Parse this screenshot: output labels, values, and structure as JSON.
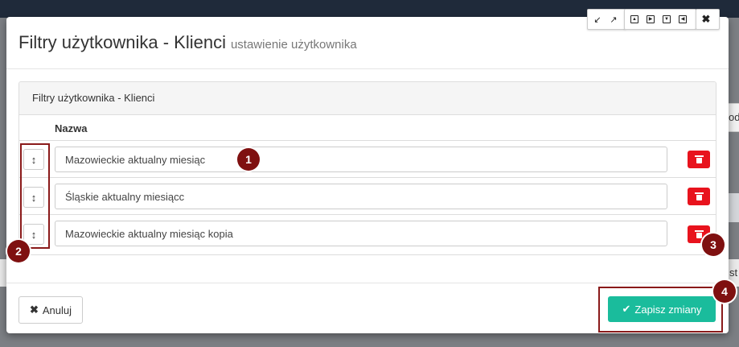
{
  "modal": {
    "title": "Filtry użytkownika - Klienci",
    "subtitle": "ustawienie użytkownika"
  },
  "window_controls": [
    "minimize-icon",
    "maximize-icon",
    "move-top-icon",
    "move-right-icon",
    "move-down-icon",
    "move-left-icon",
    "close-icon"
  ],
  "panel": {
    "heading": "Filtry użytkownika - Klienci",
    "column_name": "Nazwa"
  },
  "filters": [
    {
      "name": "Mazowieckie aktualny miesiąc"
    },
    {
      "name": "Śląskie aktualny miesiącc"
    },
    {
      "name": "Mazowieckie aktualny miesiąc kopia"
    }
  ],
  "footer": {
    "cancel_label": "Anuluj",
    "save_label": "Zapisz zmiany"
  },
  "markers": [
    "1",
    "2",
    "3",
    "4"
  ],
  "background": {
    "peek_right_1": "od",
    "peek_right_2": "st"
  },
  "colors": {
    "save": "#1abc9c",
    "delete": "#e8131d",
    "marker": "#7f1010"
  }
}
